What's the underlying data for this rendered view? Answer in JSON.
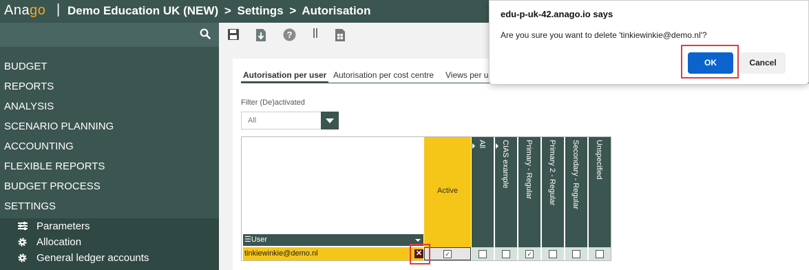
{
  "header": {
    "logo_prefix": "Ana",
    "logo_suffix": "go",
    "divider": "|",
    "crumbs": [
      "Demo Education UK (NEW)",
      ">",
      "Settings",
      ">",
      "Autorisation"
    ],
    "brand_color": "#3b5550",
    "accent_color": "#f5a623"
  },
  "sidebar": {
    "items": [
      {
        "label": "BUDGET"
      },
      {
        "label": "REPORTS"
      },
      {
        "label": "ANALYSIS"
      },
      {
        "label": "SCENARIO PLANNING"
      },
      {
        "label": "ACCOUNTING"
      },
      {
        "label": "FLEXIBLE REPORTS"
      },
      {
        "label": "BUDGET PROCESS"
      },
      {
        "label": "SETTINGS"
      }
    ],
    "subitems": [
      {
        "label": "Parameters",
        "icon": "sliders-icon"
      },
      {
        "label": "Allocation",
        "icon": "gear-icon"
      },
      {
        "label": "General ledger accounts",
        "icon": "gear-icon"
      }
    ]
  },
  "toolbar": {
    "icons": [
      "save-icon",
      "download-icon",
      "help-icon",
      "column-icon",
      "spreadsheet-icon"
    ]
  },
  "tabs": [
    {
      "label": "Autorisation per user",
      "active": true
    },
    {
      "label": "Autorisation per cost centre",
      "active": false
    },
    {
      "label": "Views per u",
      "active": false
    }
  ],
  "filter": {
    "label": "Filter (De)activated",
    "value": "All"
  },
  "grid": {
    "user_header": "☰User",
    "active_header": "Active",
    "columns": [
      "All",
      "CIAS example",
      "Primary - Regular",
      "Primary 2 - Regular",
      "Secondary - Regular",
      "Unspecified"
    ],
    "rows": [
      {
        "user": "tinkiewinkie@demo.nl",
        "delete": "✕",
        "active": true,
        "values": [
          false,
          false,
          true,
          false,
          false,
          false
        ]
      }
    ]
  },
  "dialog": {
    "title": "edu-p-uk-42.anago.io says",
    "message": "Are you sure you want to delete 'tinkiewinkie@demo.nl'?",
    "ok": "OK",
    "cancel": "Cancel"
  }
}
